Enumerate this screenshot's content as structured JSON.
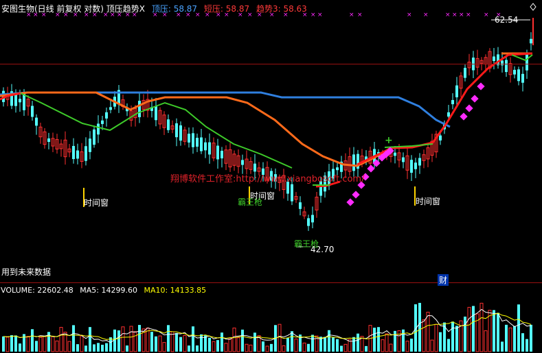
{
  "header": {
    "title": "安图生物(日线 前复权 对数) 顶压趋势X",
    "resist_label": "顶压: 58.87",
    "short_label": "短压: 58.87",
    "trend_label": "趋势3: 58.63"
  },
  "annotations": {
    "high_price": "62.54",
    "low_price": "42.70",
    "window_1": "时间窗",
    "window_2": "时间窗",
    "window_3": "时间窗",
    "overlord_1": "霸王枪",
    "overlord_2": "霸王枪",
    "future_data": "用到未来数据",
    "finance_badge": "财",
    "plus_marker": "+",
    "watermark": "翔博软件工作室:http://www.xiangbosoft.com/"
  },
  "volume_header": {
    "volume_label": "VOLUME: 22602.48",
    "ma5_label": "MA5: 14299.60",
    "ma10_label": "MA10: 14133.85"
  },
  "colors": {
    "up": "#ff3030",
    "down": "#54ffff",
    "resist_line": "#2f7fdf",
    "short_line": "#ff6a1a",
    "trend_line": "#ff1a1a",
    "green_line": "#3ecb2a",
    "diamond": "#ff2bff",
    "window_text": "#ffffff",
    "overlord_text": "#3ecb2a",
    "ma5": "#ffffff",
    "ma10": "#ffff00",
    "header_resist": "#4aa3ff",
    "header_short": "#ff3a3a",
    "header_trend": "#ff3a3a"
  },
  "chart_data": {
    "type": "candlestick",
    "scale": "log",
    "ylim": [
      42,
      64
    ],
    "price_high": 62.54,
    "price_low": 42.7,
    "resist_value": 58.87,
    "short_value": 58.87,
    "trend_value": 58.63,
    "volume": 22602.48,
    "ma5": 14299.6,
    "ma10": 14133.85
  }
}
